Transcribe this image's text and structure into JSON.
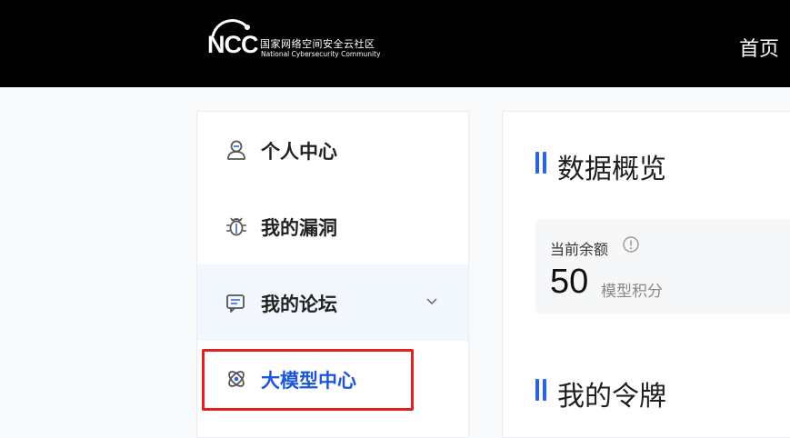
{
  "header": {
    "logo": {
      "mark": "NCC",
      "name_cn": "国家网络空间安全云社区",
      "name_en": "National Cybersecurity Community"
    },
    "nav_home": "首页"
  },
  "sidebar": {
    "items": [
      {
        "label": "个人中心",
        "icon": "user-icon"
      },
      {
        "label": "我的漏洞",
        "icon": "bug-icon"
      },
      {
        "label": "我的论坛",
        "icon": "forum-icon",
        "expand_icon": "chevron-down-icon"
      },
      {
        "label": "大模型中心",
        "icon": "atom-icon",
        "active": true
      }
    ]
  },
  "main": {
    "overview_title": "数据概览",
    "balance": {
      "label": "当前余额",
      "info_icon": "info-icon",
      "value": "50",
      "unit": "模型积分"
    },
    "tokens_title": "我的令牌"
  },
  "colors": {
    "header_bg": "#000000",
    "accent": "#2b63e8",
    "active_text": "#1a56d6",
    "highlight_border": "#e02020",
    "hover_bg": "#f2f7fd"
  }
}
